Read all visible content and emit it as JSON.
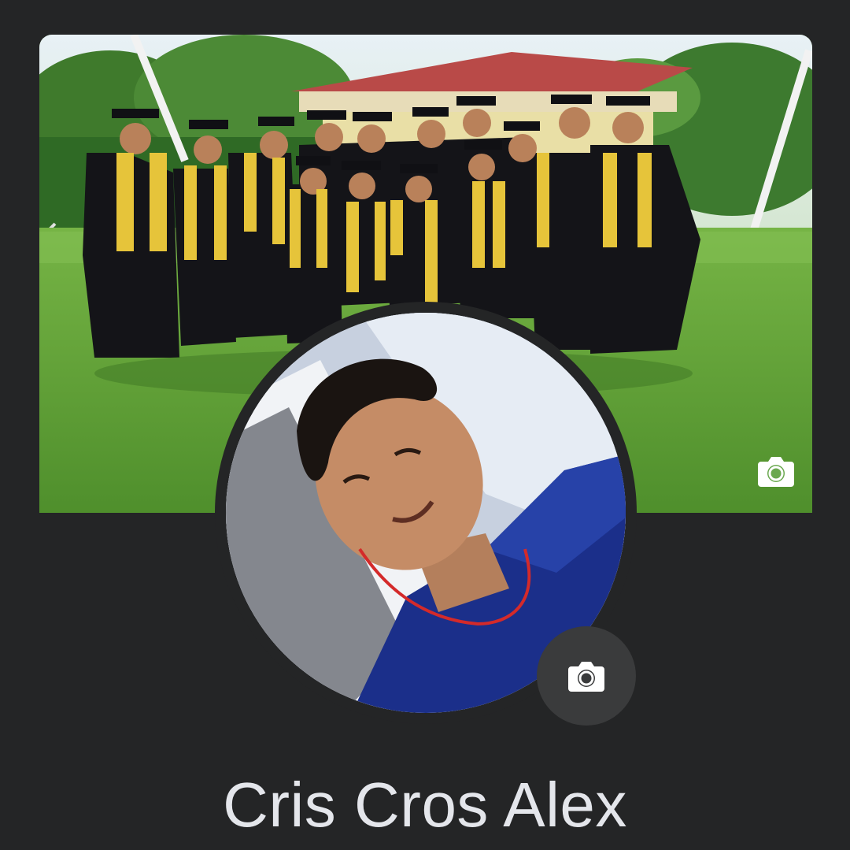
{
  "profile": {
    "name": "Cris Cros Alex"
  },
  "cover_photo": {
    "camera_icon": "camera-icon"
  },
  "profile_picture": {
    "camera_icon": "camera-icon"
  },
  "colors": {
    "background": "#242526",
    "name_text": "#e4e6eb",
    "avatar_button_bg": "#3a3b3c",
    "icon_white": "#ffffff"
  }
}
